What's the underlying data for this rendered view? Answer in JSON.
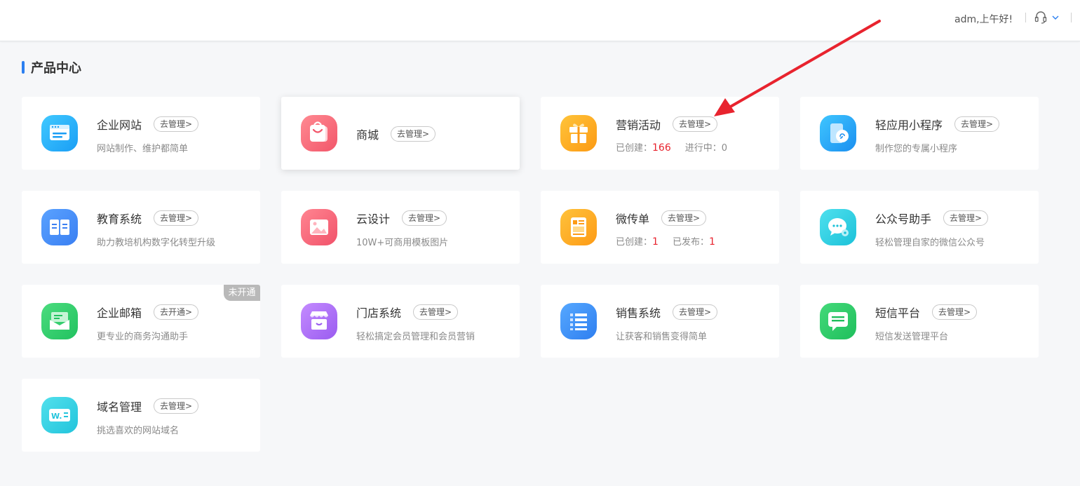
{
  "header": {
    "greeting": "adm,上午好!"
  },
  "section": {
    "title": "产品中心"
  },
  "colors": {
    "accent": "#2b7ff0",
    "highlight_number": "#e8232e",
    "annotation_arrow": "#e8232e"
  },
  "cards": [
    {
      "title": "企业网站",
      "button": "去管理>",
      "desc": "网站制作、维护都简单",
      "icon": "website-icon"
    },
    {
      "title": "商城",
      "button": "去管理>",
      "icon": "shopping-bag-icon"
    },
    {
      "title": "营销活动",
      "button": "去管理>",
      "icon": "gift-icon",
      "stats": [
        {
          "label": "已创建：",
          "value": "166"
        },
        {
          "label": "进行中：",
          "value": "0"
        }
      ]
    },
    {
      "title": "轻应用小程序",
      "button": "去管理>",
      "desc": "制作您的专属小程序",
      "icon": "mini-program-icon"
    },
    {
      "title": "教育系统",
      "button": "去管理>",
      "desc": "助力教培机构数字化转型升级",
      "icon": "book-icon"
    },
    {
      "title": "云设计",
      "button": "去管理>",
      "desc": "10W+可商用模板图片",
      "icon": "image-icon"
    },
    {
      "title": "微传单",
      "button": "去管理>",
      "icon": "flyer-icon",
      "stats": [
        {
          "label": "已创建：",
          "value": "1"
        },
        {
          "label": "已发布：",
          "value": "1"
        }
      ]
    },
    {
      "title": "公众号助手",
      "button": "去管理>",
      "desc": "轻松管理自家的微信公众号",
      "icon": "wechat-icon"
    },
    {
      "title": "企业邮箱",
      "button": "去开通>",
      "desc": "更专业的商务沟通助手",
      "icon": "mail-icon",
      "badge": "未开通"
    },
    {
      "title": "门店系统",
      "button": "去管理>",
      "desc": "轻松搞定会员管理和会员营销",
      "icon": "store-icon"
    },
    {
      "title": "销售系统",
      "button": "去管理>",
      "desc": "让获客和销售变得简单",
      "icon": "list-icon"
    },
    {
      "title": "短信平台",
      "button": "去管理>",
      "desc": "短信发送管理平台",
      "icon": "sms-icon"
    },
    {
      "title": "域名管理",
      "button": "去管理>",
      "desc": "挑选喜欢的网站域名",
      "icon": "domain-icon"
    }
  ]
}
